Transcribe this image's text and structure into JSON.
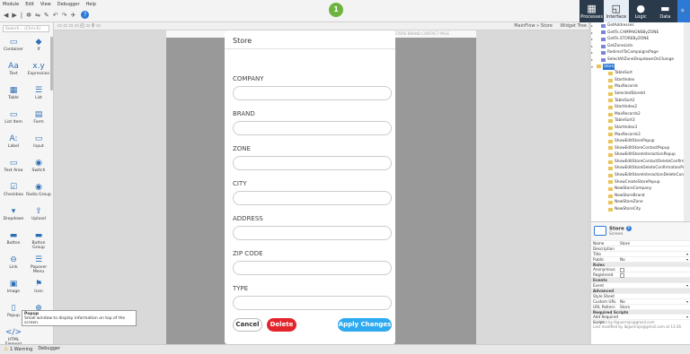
{
  "menu": [
    "Module",
    "Edit",
    "View",
    "Debugger",
    "Help"
  ],
  "toolbar": {
    "badge": "1",
    "help": "?"
  },
  "right_tabs": [
    {
      "icon": "▦",
      "label": "Processes"
    },
    {
      "icon": "◱",
      "label": "Interface"
    },
    {
      "icon": "●",
      "label": "Logic"
    },
    {
      "icon": "▬",
      "label": "Data"
    }
  ],
  "left": {
    "search_placeholder": "Search... (Ctrl+E)",
    "widgets": [
      {
        "label": "Container",
        "icon": "▭"
      },
      {
        "label": "If",
        "icon": "◆"
      },
      {
        "label": "Text",
        "icon": "Aa"
      },
      {
        "label": "Expression",
        "icon": "x.y"
      },
      {
        "label": "Table",
        "icon": "▦"
      },
      {
        "label": "List",
        "icon": "☰"
      },
      {
        "label": "List Item",
        "icon": "▭"
      },
      {
        "label": "Form",
        "icon": "▤"
      },
      {
        "label": "Label",
        "icon": "A:"
      },
      {
        "label": "Input",
        "icon": "▭"
      },
      {
        "label": "Text Area",
        "icon": "▭"
      },
      {
        "label": "Switch",
        "icon": "◉"
      },
      {
        "label": "Checkbox",
        "icon": "☑"
      },
      {
        "label": "Radio Group",
        "icon": "◉"
      },
      {
        "label": "Dropdown",
        "icon": "▾"
      },
      {
        "label": "Upload",
        "icon": "⇪"
      },
      {
        "label": "Button",
        "icon": "▬"
      },
      {
        "label": "Button Group",
        "icon": "▬"
      },
      {
        "label": "Link",
        "icon": "⊖"
      },
      {
        "label": "Popover Menu",
        "icon": "☰"
      },
      {
        "label": "Image",
        "icon": "▣"
      },
      {
        "label": "Icon",
        "icon": "⚑"
      },
      {
        "label": "Popup",
        "icon": "▯"
      },
      {
        "label": "",
        "icon": "⊕"
      },
      {
        "label": "HTML Element",
        "icon": "</>"
      }
    ],
    "tooltip_title": "Popup",
    "tooltip_text": "Small window to display information on top of the screen."
  },
  "canvas": {
    "breadcrumb": "MainFlow » Store",
    "widget_tree": "Widget Tree",
    "device_top": "STORE  BRAND  CONTACT  PAGE"
  },
  "popup": {
    "title": "Store",
    "fields": [
      "COMPANY",
      "BRAND",
      "ZONE",
      "CITY",
      "ADDRESS",
      "ZIP CODE",
      "TYPE"
    ],
    "cancel": "Cancel",
    "delete": "Delete",
    "apply": "Apply Changes"
  },
  "tree": [
    {
      "label": "GetAddresses",
      "type": "fn"
    },
    {
      "label": "GetFk.CAMPAIGNSByZONE",
      "type": "fn"
    },
    {
      "label": "GetFk.STOREByZONE",
      "type": "fn"
    },
    {
      "label": "GetZoneLists",
      "type": "fn"
    },
    {
      "label": "RedirectToCampaignsPage",
      "type": "fn"
    },
    {
      "label": "SelectAllZoneDropdownOnChange",
      "type": "fn"
    },
    {
      "label": "Store",
      "type": "sel"
    },
    {
      "label": "TableSort",
      "type": "folder"
    },
    {
      "label": "StartIndex",
      "type": "folder"
    },
    {
      "label": "MaxRecords",
      "type": "folder"
    },
    {
      "label": "SelectedStoreId",
      "type": "folder"
    },
    {
      "label": "TableSort2",
      "type": "folder"
    },
    {
      "label": "StartIndex2",
      "type": "folder"
    },
    {
      "label": "MaxRecords2",
      "type": "folder"
    },
    {
      "label": "TableSort3",
      "type": "folder"
    },
    {
      "label": "StartIndex3",
      "type": "folder"
    },
    {
      "label": "MaxRecords3",
      "type": "folder"
    },
    {
      "label": "ShowEditStorePopup",
      "type": "folder"
    },
    {
      "label": "ShowEditStoreContactPopup",
      "type": "folder"
    },
    {
      "label": "ShowEditStoreInteractionPopup",
      "type": "folder"
    },
    {
      "label": "ShowEditStoreContactDeleteConfirmation",
      "type": "folder"
    },
    {
      "label": "ShowEditStoreDeleteConfirmationPopup",
      "type": "folder"
    },
    {
      "label": "ShowEditStoreInteractionDeleteConfirmation",
      "type": "folder"
    },
    {
      "label": "ShowCreateStorePopup",
      "type": "folder"
    },
    {
      "label": "NewStoreCompany",
      "type": "folder"
    },
    {
      "label": "NewStoreBrand",
      "type": "folder"
    },
    {
      "label": "NewStoreZone",
      "type": "folder"
    },
    {
      "label": "NewStoreCity",
      "type": "folder"
    }
  ],
  "props": {
    "title": "Store",
    "subtitle": "Screen",
    "help": "?",
    "rows": [
      {
        "k": "Name",
        "v": "Store"
      },
      {
        "k": "Description",
        "v": ""
      },
      {
        "k": "Title",
        "v": "",
        "dd": true
      },
      {
        "k": "Public",
        "v": "No",
        "dd": true
      },
      {
        "sec": "Roles"
      },
      {
        "k": "Anonymous",
        "chk": true
      },
      {
        "k": "Registered",
        "chk": true
      },
      {
        "sec": "Events"
      },
      {
        "k": "Event",
        "v": "",
        "dd": true
      },
      {
        "sec": "Advanced"
      },
      {
        "k": "Style Sheet",
        "v": ""
      },
      {
        "k": "Custom URL",
        "v": "No",
        "dd": true
      },
      {
        "k": "URL Pattern",
        "v": "Store"
      },
      {
        "sec": "Required Scripts"
      },
      {
        "k": "Add Required Script",
        "v": "",
        "dd": true
      }
    ],
    "foot1": "Created by lbguerrajo@gmail.com",
    "foot2": "Last modified by lbguerrajo@gmail.com at 13:36"
  },
  "status": {
    "warning": "1 Warning",
    "debugger": "Debugger"
  }
}
